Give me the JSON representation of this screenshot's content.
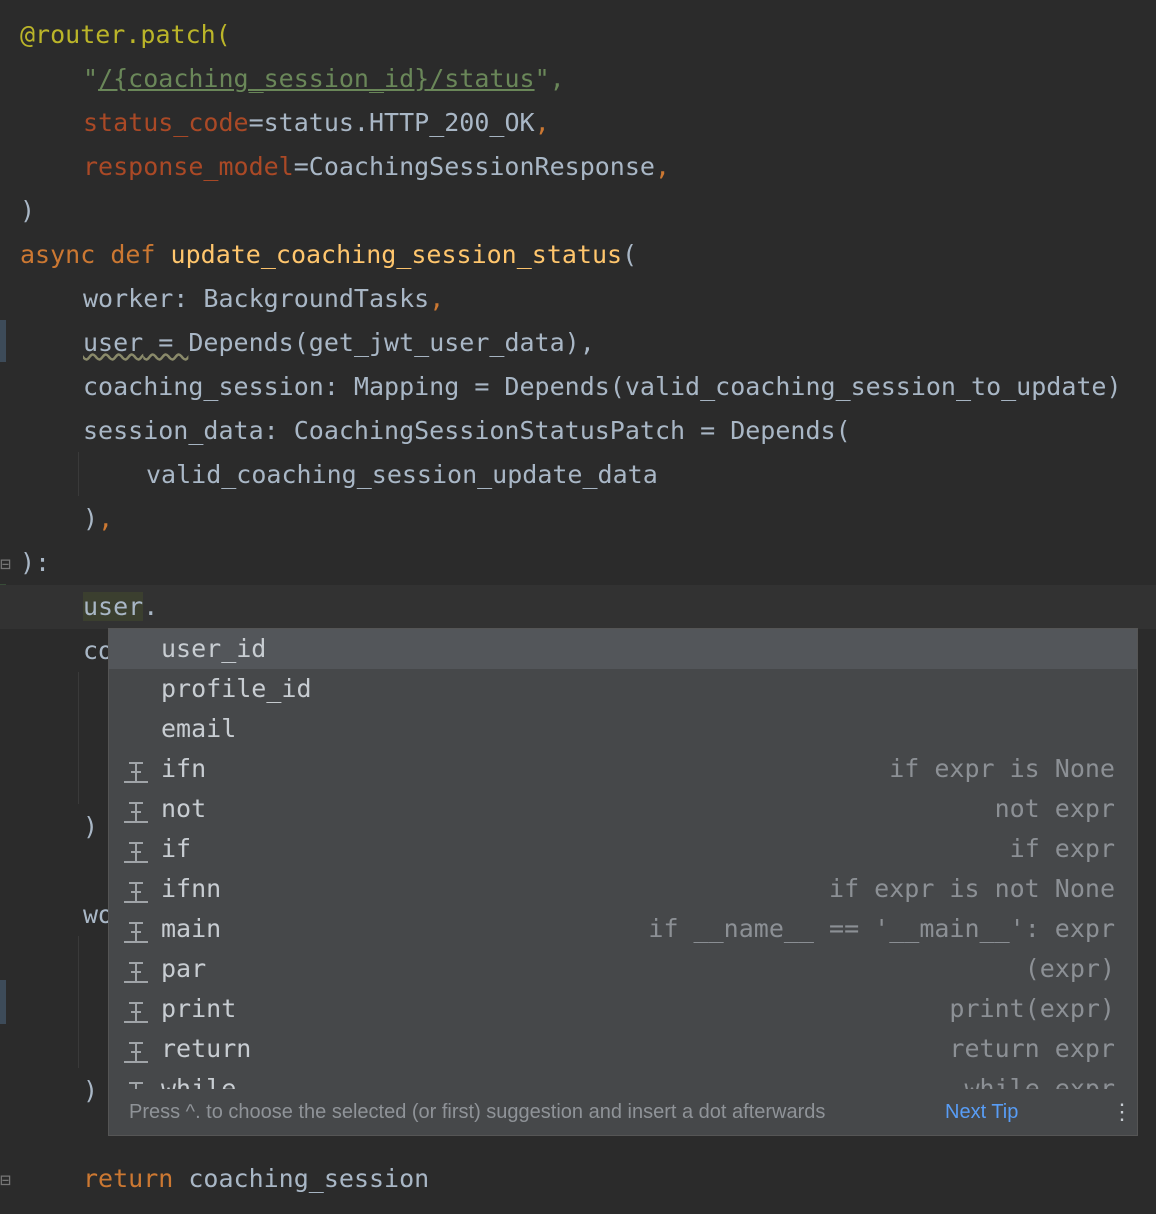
{
  "code": {
    "decorator": "@router.patch(",
    "path_open_quote": "\"",
    "path": "/{coaching_session_id}/status",
    "path_close_quote": "\",",
    "status_param": "status_code",
    "status_value": "=status.HTTP_200_OK",
    "response_param": "response_model",
    "response_value": "=CoachingSessionResponse",
    "close_paren": ")",
    "async_kw": "async",
    "def_kw": "def",
    "func_name": "update_coaching_session_status",
    "open_paren": "(",
    "worker_line": "worker: BackgroundTasks",
    "user_name": "user",
    "user_eq": " = ",
    "user_value": "Depends(get_jwt_user_data),",
    "coaching_line": "coaching_session: Mapping = Depends(valid_coaching_session_to_update)",
    "session_data_line": "session_data: CoachingSessionStatusPatch = Depends(",
    "valid_line": "valid_coaching_session_update_data",
    "close_paren_comma": "),",
    "sig_close": "):",
    "current_user": "user",
    "current_dot": ".",
    "partial_co": "co",
    "partial_close1": ")",
    "partial_wo": "wo",
    "partial_close2": ")",
    "return_kw": "return",
    "return_value": "coaching_session",
    "comma": ","
  },
  "completion": {
    "items": [
      {
        "name": "user_id",
        "tail": "",
        "icon": "none",
        "selected": true
      },
      {
        "name": "profile_id",
        "tail": "",
        "icon": "none"
      },
      {
        "name": "email",
        "tail": "",
        "icon": "none"
      },
      {
        "name": "ifn",
        "tail": "if expr is None",
        "icon": "postfix-template-icon"
      },
      {
        "name": "not",
        "tail": "not expr",
        "icon": "postfix-template-icon"
      },
      {
        "name": "if",
        "tail": "if expr",
        "icon": "postfix-template-icon"
      },
      {
        "name": "ifnn",
        "tail": "if expr is not None",
        "icon": "postfix-template-icon"
      },
      {
        "name": "main",
        "tail": "if __name__ == '__main__': expr",
        "icon": "postfix-template-icon"
      },
      {
        "name": "par",
        "tail": "(expr)",
        "icon": "postfix-template-icon"
      },
      {
        "name": "print",
        "tail": "print(expr)",
        "icon": "postfix-template-icon"
      },
      {
        "name": "return",
        "tail": "return expr",
        "icon": "postfix-template-icon"
      },
      {
        "name": "while",
        "tail": "while expr",
        "icon": "postfix-template-icon"
      }
    ],
    "hint": "Press ^. to choose the selected (or first) suggestion and insert a dot afterwards",
    "next_tip": "Next Tip",
    "menu": "⋮"
  },
  "colors": {
    "background": "#2b2b2b",
    "keyword": "#cc7832",
    "string": "#6a8759",
    "function": "#ffc66d",
    "parameter": "#aa4926",
    "decorator": "#bbb529",
    "link": "#589df6"
  }
}
